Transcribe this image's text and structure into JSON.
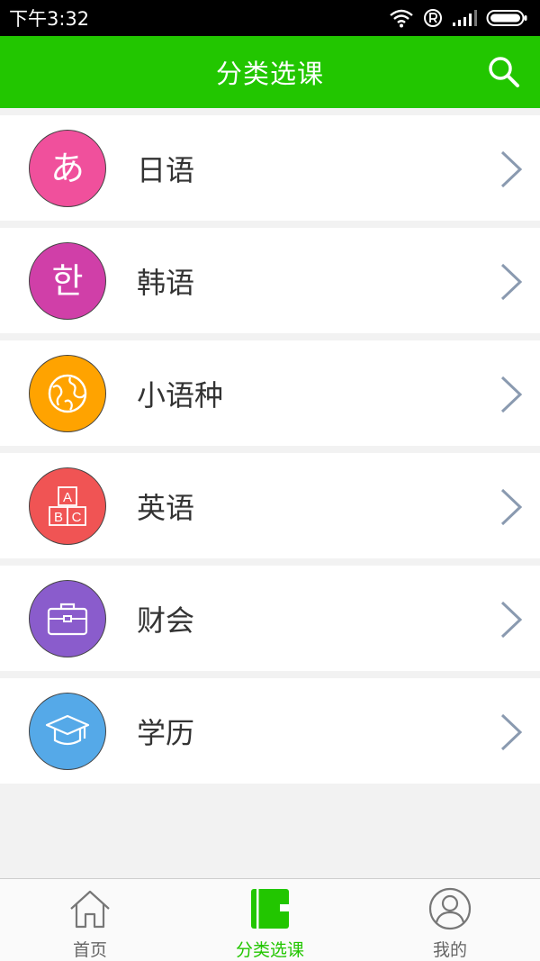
{
  "status_bar": {
    "time": "下午3:32"
  },
  "header": {
    "title": "分类选课",
    "search_icon": "search-icon"
  },
  "categories": [
    {
      "label": "日语",
      "glyph": "あ",
      "icon": "hiragana-icon",
      "color": "#f0509c"
    },
    {
      "label": "韩语",
      "glyph": "한",
      "icon": "hangul-icon",
      "color": "#d03fa8"
    },
    {
      "label": "小语种",
      "glyph": "",
      "icon": "globe-icon",
      "color": "#ffa300"
    },
    {
      "label": "英语",
      "glyph": "",
      "icon": "abc-blocks-icon",
      "color": "#f05454"
    },
    {
      "label": "财会",
      "glyph": "",
      "icon": "briefcase-icon",
      "color": "#8a5ccc"
    },
    {
      "label": "学历",
      "glyph": "",
      "icon": "graduation-cap-icon",
      "color": "#55a9e8"
    }
  ],
  "abc_letters": [
    "A",
    "B",
    "C"
  ],
  "tabs": [
    {
      "label": "首页",
      "icon": "home-icon",
      "active": false
    },
    {
      "label": "分类选课",
      "icon": "book-icon",
      "active": true
    },
    {
      "label": "我的",
      "icon": "user-icon",
      "active": false
    }
  ],
  "colors": {
    "header": "#22c600",
    "active_tab": "#22c600",
    "chevron": "#8a9ab0"
  }
}
